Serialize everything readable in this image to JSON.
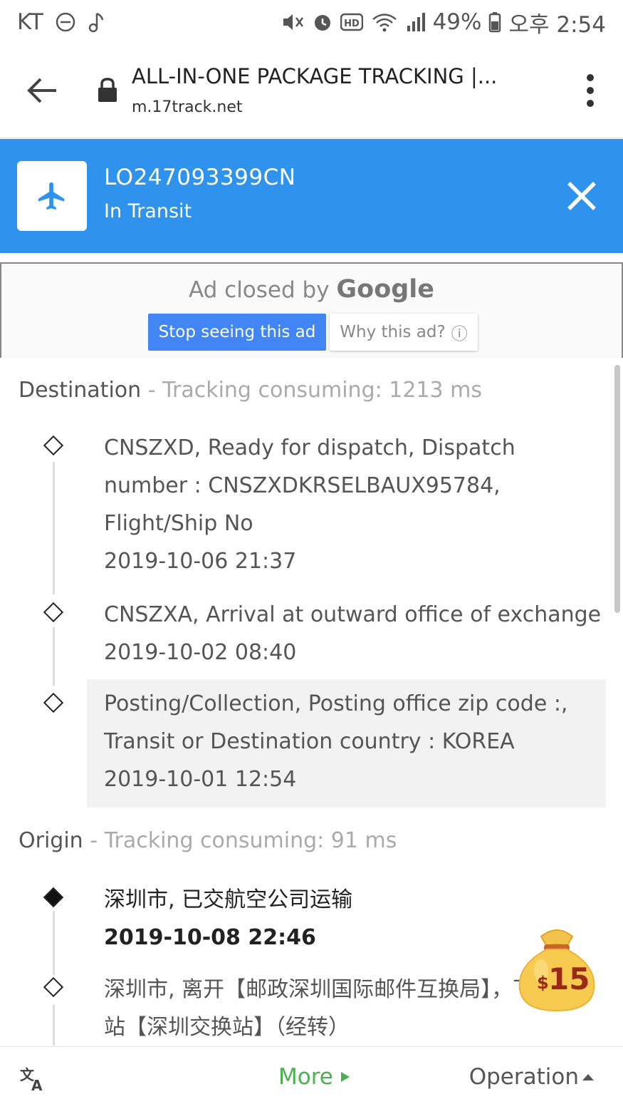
{
  "status_bar": {
    "carrier": "KT",
    "battery": "49%",
    "time": "오후 2:54"
  },
  "browser": {
    "title": "ALL-IN-ONE PACKAGE TRACKING |...",
    "url": "m.17track.net"
  },
  "tracking": {
    "number": "LO247093399CN",
    "status": "In Transit"
  },
  "ad": {
    "closed_prefix": "Ad closed by",
    "closed_brand": "Google",
    "stop_label": "Stop seeing this ad",
    "why_label": "Why this ad?",
    "why_icon": "ⓘ"
  },
  "destination": {
    "label": "Destination",
    "separator": " - ",
    "consuming": "Tracking consuming: 1213 ms",
    "events": [
      {
        "lines": [
          "CNSZXD, Ready for dispatch, Dispatch",
          "number : CNSZXDKRSELBAUX95784,",
          "Flight/Ship No"
        ],
        "time": "2019-10-06 21:37"
      },
      {
        "lines": [
          "CNSZXA, Arrival at outward office of exchange"
        ],
        "time": "2019-10-02 08:40"
      },
      {
        "lines": [
          "Posting/Collection, Posting office zip code :,",
          "Transit or Destination country : KOREA"
        ],
        "time": "2019-10-01 12:54"
      }
    ]
  },
  "origin": {
    "label": "Origin",
    "separator": " - ",
    "consuming": "Tracking consuming: 91 ms",
    "events": [
      {
        "lines": [
          "深圳市, 已交航空公司运输"
        ],
        "time": "2019-10-08 22:46"
      },
      {
        "lines": [
          "深圳市, 离开【邮政深圳国际邮件互换局】，下",
          "站【深圳交换站】（经转）"
        ],
        "time": ""
      }
    ]
  },
  "reward": {
    "currency": "$",
    "amount": "15"
  },
  "bottom": {
    "more_label": "More",
    "operation_label": "Operation"
  },
  "colors": {
    "header_blue": "#2f93ee",
    "more_green": "#4caf50",
    "google_blue": "#4285f4"
  }
}
